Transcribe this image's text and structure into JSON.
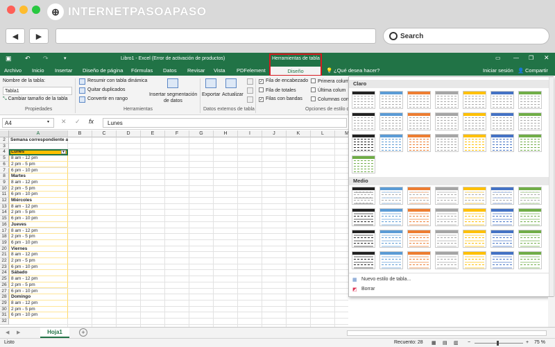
{
  "browser": {
    "logo_mark": "⊕",
    "logo_text": "INTERNETPASOAPASO",
    "back": "◀",
    "forward": "▶",
    "search_label": "Search"
  },
  "excel": {
    "window_title": "Libro1 - Excel (Error de activación de productos)",
    "context_tab_group": "Herramientas de tabla",
    "tabs": [
      "Archivo",
      "Inicio",
      "Insertar",
      "Diseño de página",
      "Fórmulas",
      "Datos",
      "Revisar",
      "Vista",
      "PDFelement"
    ],
    "active_tab": "Diseño",
    "tell_me": "¿Qué desea hacer?",
    "signin": "Iniciar sesión",
    "share": "Compartir",
    "ribbon": {
      "table_name_label": "Nombre de la tabla:",
      "table_name_value": "Tabla1",
      "resize": "Cambiar tamaño de la tabla",
      "group_properties": "Propiedades",
      "summarize": "Resumir con tabla dinámica",
      "remove_dupes": "Quitar duplicados",
      "convert_range": "Convertir en rango",
      "slicer_1": "Insertar segmentación",
      "slicer_2": "de datos",
      "group_tools": "Herramientas",
      "export": "Exportar",
      "refresh": "Actualizar",
      "group_external": "Datos externos de tabla",
      "opt_header": "Fila de encabezado",
      "opt_totals": "Fila de totales",
      "opt_banded": "Filas con bandas",
      "opt_first": "Primera colum",
      "opt_last": "Última colum",
      "opt_cols": "Columnas con",
      "group_options": "Opciones de estilo de"
    },
    "name_box": "A4",
    "formula_value": "Lunes",
    "fx": "fx",
    "columns": [
      "A",
      "B",
      "C",
      "D",
      "E",
      "F",
      "G",
      "H",
      "I",
      "J",
      "K",
      "L",
      "M"
    ],
    "rows": [
      {
        "n": "2",
        "a": "Semana correspondiente a:",
        "bold": true
      },
      {
        "n": "3",
        "a": ""
      },
      {
        "n": "4",
        "a": "Lunes",
        "header": true
      },
      {
        "n": "5",
        "a": "8 am - 12 pm"
      },
      {
        "n": "6",
        "a": "2 pm - 5 pm"
      },
      {
        "n": "7",
        "a": "6 pm - 10 pm"
      },
      {
        "n": "8",
        "a": "Martes",
        "bold": true
      },
      {
        "n": "9",
        "a": "8 am - 12 pm"
      },
      {
        "n": "10",
        "a": "2 pm - 5 pm"
      },
      {
        "n": "11",
        "a": "6 pm - 10 pm"
      },
      {
        "n": "12",
        "a": "Miércoles",
        "bold": true
      },
      {
        "n": "13",
        "a": "8 am - 12 pm"
      },
      {
        "n": "14",
        "a": "2 pm - 5 pm"
      },
      {
        "n": "15",
        "a": "6 pm - 10 pm"
      },
      {
        "n": "16",
        "a": "Jueves",
        "bold": true
      },
      {
        "n": "17",
        "a": "8 am - 12 pm"
      },
      {
        "n": "18",
        "a": "2 pm - 5 pm"
      },
      {
        "n": "19",
        "a": "6 pm - 10 pm"
      },
      {
        "n": "20",
        "a": "Viernes",
        "bold": true
      },
      {
        "n": "21",
        "a": "8 am - 12 pm"
      },
      {
        "n": "22",
        "a": "2 pm - 5 pm"
      },
      {
        "n": "23",
        "a": "6 pm - 10 pm"
      },
      {
        "n": "24",
        "a": "Sábado",
        "bold": true
      },
      {
        "n": "25",
        "a": "8 am - 12 pm"
      },
      {
        "n": "26",
        "a": "2 pm - 5 pm"
      },
      {
        "n": "27",
        "a": "6 pm - 10 pm"
      },
      {
        "n": "28",
        "a": "Domingo",
        "bold": true
      },
      {
        "n": "29",
        "a": "8 am - 12 pm"
      },
      {
        "n": "30",
        "a": "2 pm - 5 pm"
      },
      {
        "n": "31",
        "a": "6 pm - 10 pm"
      },
      {
        "n": "32",
        "a": ""
      }
    ],
    "sheet_tab": "Hoja1",
    "add_sheet": "+",
    "status_ready": "Listo",
    "status_count": "Recuento: 28",
    "zoom": "75 %",
    "gallery": {
      "light": "Claro",
      "medium": "Medio",
      "new_style": "Nuevo estilo de tabla...",
      "clear": "Borrar",
      "palette": [
        "#222222",
        "#5b9bd5",
        "#ed7d31",
        "#a5a5a5",
        "#ffc000",
        "#4472c4",
        "#70ad47"
      ]
    }
  }
}
